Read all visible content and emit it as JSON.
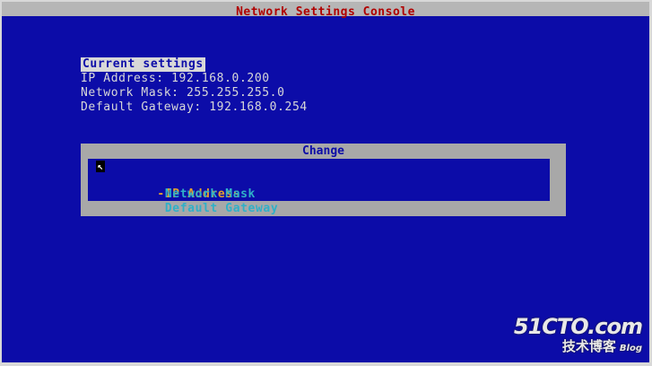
{
  "title": "Network Settings Console",
  "current": {
    "heading": "Current settings",
    "ip_line": "IP Address: 192.168.0.200",
    "mask_line": "Network Mask: 255.255.255.0",
    "gateway_line": "Default Gateway: 192.168.0.254"
  },
  "change_dialog": {
    "title": "Change",
    "items": [
      {
        "label": "IP Address",
        "selected": true
      },
      {
        "label": "Network Mask",
        "selected": false
      },
      {
        "label": "Default Gateway",
        "selected": false
      }
    ]
  },
  "watermark": {
    "brand": "51CTO.com",
    "sub": "技术博客",
    "blog": "Blog"
  },
  "colors": {
    "background": "#0c0ca8",
    "title_text": "#b00000",
    "selected_item": "#e0a030",
    "menu_item": "#2fb0c8"
  }
}
